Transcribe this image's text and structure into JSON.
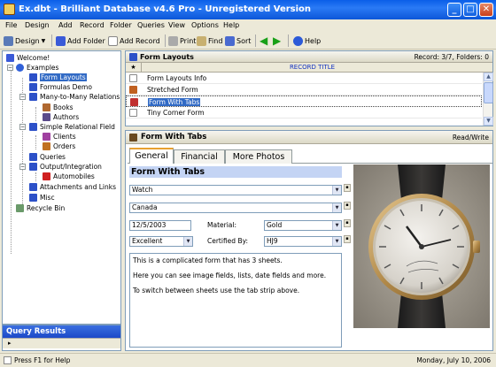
{
  "window": {
    "title": "Ex.dbt - Brilliant Database v4.6 Pro - Unregistered Version",
    "buttons": {
      "minimize": "_",
      "maximize": "□",
      "close": "✕"
    }
  },
  "menu": [
    "File",
    "Design",
    "Add",
    "Record",
    "Folder",
    "Queries",
    "View",
    "Options",
    "Help"
  ],
  "toolbar": {
    "design": "Design",
    "add_folder": "Add Folder",
    "add_record": "Add Record",
    "print": "Print",
    "find": "Find",
    "sort": "Sort",
    "help": "Help"
  },
  "tree": {
    "welcome": "Welcome!",
    "examples": "Examples",
    "form_layouts": "Form Layouts",
    "formulas_demo": "Formulas Demo",
    "many_to_many": "Many-to-Many Relations",
    "books": "Books",
    "authors": "Authors",
    "simple_relational": "Simple Relational Field",
    "clients": "Clients",
    "orders": "Orders",
    "queries": "Queries",
    "output_integration": "Output/Integration",
    "automobiles": "Automobiles",
    "attachments": "Attachments and Links",
    "misc": "Misc",
    "recycle_bin": "Recycle Bin"
  },
  "query_panel": {
    "title": "Query Results",
    "row": "▸"
  },
  "list": {
    "title": "Form Layouts",
    "record_info": "Record: 3/7, Folders: 0",
    "col_marker": "★",
    "column": "RECORD TITLE",
    "rows": [
      "Form Layouts Info",
      "Stretched Form",
      "Form With Tabs",
      "Tiny Corner Form"
    ]
  },
  "form": {
    "title": "Form With Tabs",
    "mode": "Read/Write",
    "tabs": [
      "General",
      "Financial",
      "More Photos"
    ],
    "section_title": "Form With Tabs",
    "field_item": "Watch",
    "field_country": "Canada",
    "field_date": "12/5/2003",
    "material_label": "Material:",
    "material_value": "Gold",
    "condition_value": "Excellent",
    "certified_label": "Certified By:",
    "certified_value": "HJ9",
    "memo_lines": [
      "This is a complicated form that has 3 sheets.",
      "Here you can see image fields, lists, date fields and more.",
      "To switch between sheets use the tab strip above."
    ]
  },
  "status": {
    "left": "Press F1 for Help",
    "right": "Monday, July 10, 2006"
  }
}
